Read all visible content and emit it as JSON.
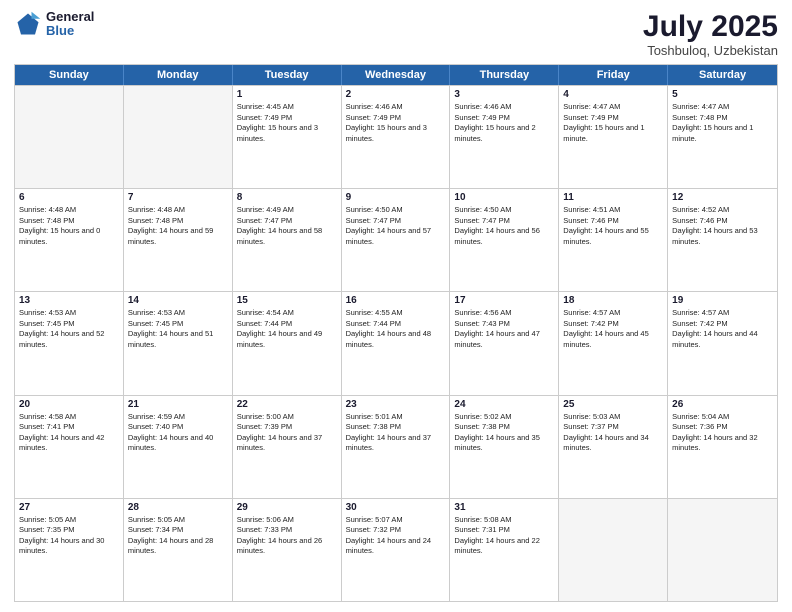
{
  "header": {
    "logo_general": "General",
    "logo_blue": "Blue",
    "month_year": "July 2025",
    "location": "Toshbuloq, Uzbekistan"
  },
  "days_of_week": [
    "Sunday",
    "Monday",
    "Tuesday",
    "Wednesday",
    "Thursday",
    "Friday",
    "Saturday"
  ],
  "weeks": [
    [
      {
        "day": "",
        "sunrise": "",
        "sunset": "",
        "daylight": ""
      },
      {
        "day": "",
        "sunrise": "",
        "sunset": "",
        "daylight": ""
      },
      {
        "day": "1",
        "sunrise": "Sunrise: 4:45 AM",
        "sunset": "Sunset: 7:49 PM",
        "daylight": "Daylight: 15 hours and 3 minutes."
      },
      {
        "day": "2",
        "sunrise": "Sunrise: 4:46 AM",
        "sunset": "Sunset: 7:49 PM",
        "daylight": "Daylight: 15 hours and 3 minutes."
      },
      {
        "day": "3",
        "sunrise": "Sunrise: 4:46 AM",
        "sunset": "Sunset: 7:49 PM",
        "daylight": "Daylight: 15 hours and 2 minutes."
      },
      {
        "day": "4",
        "sunrise": "Sunrise: 4:47 AM",
        "sunset": "Sunset: 7:49 PM",
        "daylight": "Daylight: 15 hours and 1 minute."
      },
      {
        "day": "5",
        "sunrise": "Sunrise: 4:47 AM",
        "sunset": "Sunset: 7:48 PM",
        "daylight": "Daylight: 15 hours and 1 minute."
      }
    ],
    [
      {
        "day": "6",
        "sunrise": "Sunrise: 4:48 AM",
        "sunset": "Sunset: 7:48 PM",
        "daylight": "Daylight: 15 hours and 0 minutes."
      },
      {
        "day": "7",
        "sunrise": "Sunrise: 4:48 AM",
        "sunset": "Sunset: 7:48 PM",
        "daylight": "Daylight: 14 hours and 59 minutes."
      },
      {
        "day": "8",
        "sunrise": "Sunrise: 4:49 AM",
        "sunset": "Sunset: 7:47 PM",
        "daylight": "Daylight: 14 hours and 58 minutes."
      },
      {
        "day": "9",
        "sunrise": "Sunrise: 4:50 AM",
        "sunset": "Sunset: 7:47 PM",
        "daylight": "Daylight: 14 hours and 57 minutes."
      },
      {
        "day": "10",
        "sunrise": "Sunrise: 4:50 AM",
        "sunset": "Sunset: 7:47 PM",
        "daylight": "Daylight: 14 hours and 56 minutes."
      },
      {
        "day": "11",
        "sunrise": "Sunrise: 4:51 AM",
        "sunset": "Sunset: 7:46 PM",
        "daylight": "Daylight: 14 hours and 55 minutes."
      },
      {
        "day": "12",
        "sunrise": "Sunrise: 4:52 AM",
        "sunset": "Sunset: 7:46 PM",
        "daylight": "Daylight: 14 hours and 53 minutes."
      }
    ],
    [
      {
        "day": "13",
        "sunrise": "Sunrise: 4:53 AM",
        "sunset": "Sunset: 7:45 PM",
        "daylight": "Daylight: 14 hours and 52 minutes."
      },
      {
        "day": "14",
        "sunrise": "Sunrise: 4:53 AM",
        "sunset": "Sunset: 7:45 PM",
        "daylight": "Daylight: 14 hours and 51 minutes."
      },
      {
        "day": "15",
        "sunrise": "Sunrise: 4:54 AM",
        "sunset": "Sunset: 7:44 PM",
        "daylight": "Daylight: 14 hours and 49 minutes."
      },
      {
        "day": "16",
        "sunrise": "Sunrise: 4:55 AM",
        "sunset": "Sunset: 7:44 PM",
        "daylight": "Daylight: 14 hours and 48 minutes."
      },
      {
        "day": "17",
        "sunrise": "Sunrise: 4:56 AM",
        "sunset": "Sunset: 7:43 PM",
        "daylight": "Daylight: 14 hours and 47 minutes."
      },
      {
        "day": "18",
        "sunrise": "Sunrise: 4:57 AM",
        "sunset": "Sunset: 7:42 PM",
        "daylight": "Daylight: 14 hours and 45 minutes."
      },
      {
        "day": "19",
        "sunrise": "Sunrise: 4:57 AM",
        "sunset": "Sunset: 7:42 PM",
        "daylight": "Daylight: 14 hours and 44 minutes."
      }
    ],
    [
      {
        "day": "20",
        "sunrise": "Sunrise: 4:58 AM",
        "sunset": "Sunset: 7:41 PM",
        "daylight": "Daylight: 14 hours and 42 minutes."
      },
      {
        "day": "21",
        "sunrise": "Sunrise: 4:59 AM",
        "sunset": "Sunset: 7:40 PM",
        "daylight": "Daylight: 14 hours and 40 minutes."
      },
      {
        "day": "22",
        "sunrise": "Sunrise: 5:00 AM",
        "sunset": "Sunset: 7:39 PM",
        "daylight": "Daylight: 14 hours and 37 minutes."
      },
      {
        "day": "23",
        "sunrise": "Sunrise: 5:01 AM",
        "sunset": "Sunset: 7:38 PM",
        "daylight": "Daylight: 14 hours and 37 minutes."
      },
      {
        "day": "24",
        "sunrise": "Sunrise: 5:02 AM",
        "sunset": "Sunset: 7:38 PM",
        "daylight": "Daylight: 14 hours and 35 minutes."
      },
      {
        "day": "25",
        "sunrise": "Sunrise: 5:03 AM",
        "sunset": "Sunset: 7:37 PM",
        "daylight": "Daylight: 14 hours and 34 minutes."
      },
      {
        "day": "26",
        "sunrise": "Sunrise: 5:04 AM",
        "sunset": "Sunset: 7:36 PM",
        "daylight": "Daylight: 14 hours and 32 minutes."
      }
    ],
    [
      {
        "day": "27",
        "sunrise": "Sunrise: 5:05 AM",
        "sunset": "Sunset: 7:35 PM",
        "daylight": "Daylight: 14 hours and 30 minutes."
      },
      {
        "day": "28",
        "sunrise": "Sunrise: 5:05 AM",
        "sunset": "Sunset: 7:34 PM",
        "daylight": "Daylight: 14 hours and 28 minutes."
      },
      {
        "day": "29",
        "sunrise": "Sunrise: 5:06 AM",
        "sunset": "Sunset: 7:33 PM",
        "daylight": "Daylight: 14 hours and 26 minutes."
      },
      {
        "day": "30",
        "sunrise": "Sunrise: 5:07 AM",
        "sunset": "Sunset: 7:32 PM",
        "daylight": "Daylight: 14 hours and 24 minutes."
      },
      {
        "day": "31",
        "sunrise": "Sunrise: 5:08 AM",
        "sunset": "Sunset: 7:31 PM",
        "daylight": "Daylight: 14 hours and 22 minutes."
      },
      {
        "day": "",
        "sunrise": "",
        "sunset": "",
        "daylight": ""
      },
      {
        "day": "",
        "sunrise": "",
        "sunset": "",
        "daylight": ""
      }
    ]
  ]
}
